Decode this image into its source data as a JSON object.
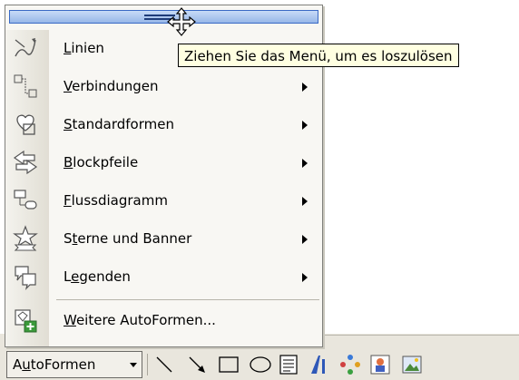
{
  "menu": {
    "items": [
      {
        "label": "Linien",
        "mnemonic": "L",
        "icon": "lines-icon",
        "submenu": false
      },
      {
        "label": "Verbindungen",
        "mnemonic": "V",
        "icon": "connectors-icon",
        "submenu": true
      },
      {
        "label": "Standardformen",
        "mnemonic": "S",
        "icon": "basic-shapes-icon",
        "submenu": true
      },
      {
        "label": "Blockpfeile",
        "mnemonic": "B",
        "icon": "block-arrows-icon",
        "submenu": true
      },
      {
        "label": "Flussdiagramm",
        "mnemonic": "F",
        "icon": "flowchart-icon",
        "submenu": true
      },
      {
        "label": "Sterne und Banner",
        "mnemonic": "t",
        "icon": "stars-banners-icon",
        "submenu": true
      },
      {
        "label": "Legenden",
        "mnemonic": "e",
        "icon": "callouts-icon",
        "submenu": true
      },
      {
        "label": "Weitere AutoFormen...",
        "mnemonic": "W",
        "icon": "more-autoshapes-icon",
        "submenu": false
      }
    ]
  },
  "tooltip": "Ziehen Sie das Menü, um es loszulösen",
  "toolbar": {
    "autoforms_label": "AutoFormen",
    "autoforms_mnemonic": "u",
    "tools": [
      "line-icon",
      "arrow-icon",
      "rectangle-icon",
      "oval-icon",
      "textbox-icon",
      "wordart-icon",
      "diagram-icon",
      "clipart-icon",
      "picture-icon"
    ]
  },
  "colors": {
    "drag_bar": "#97b7e8",
    "menu_bg": "#f8f7f3",
    "tooltip_bg": "#ffffe1",
    "toolbar_bg": "#e9e6dd"
  }
}
